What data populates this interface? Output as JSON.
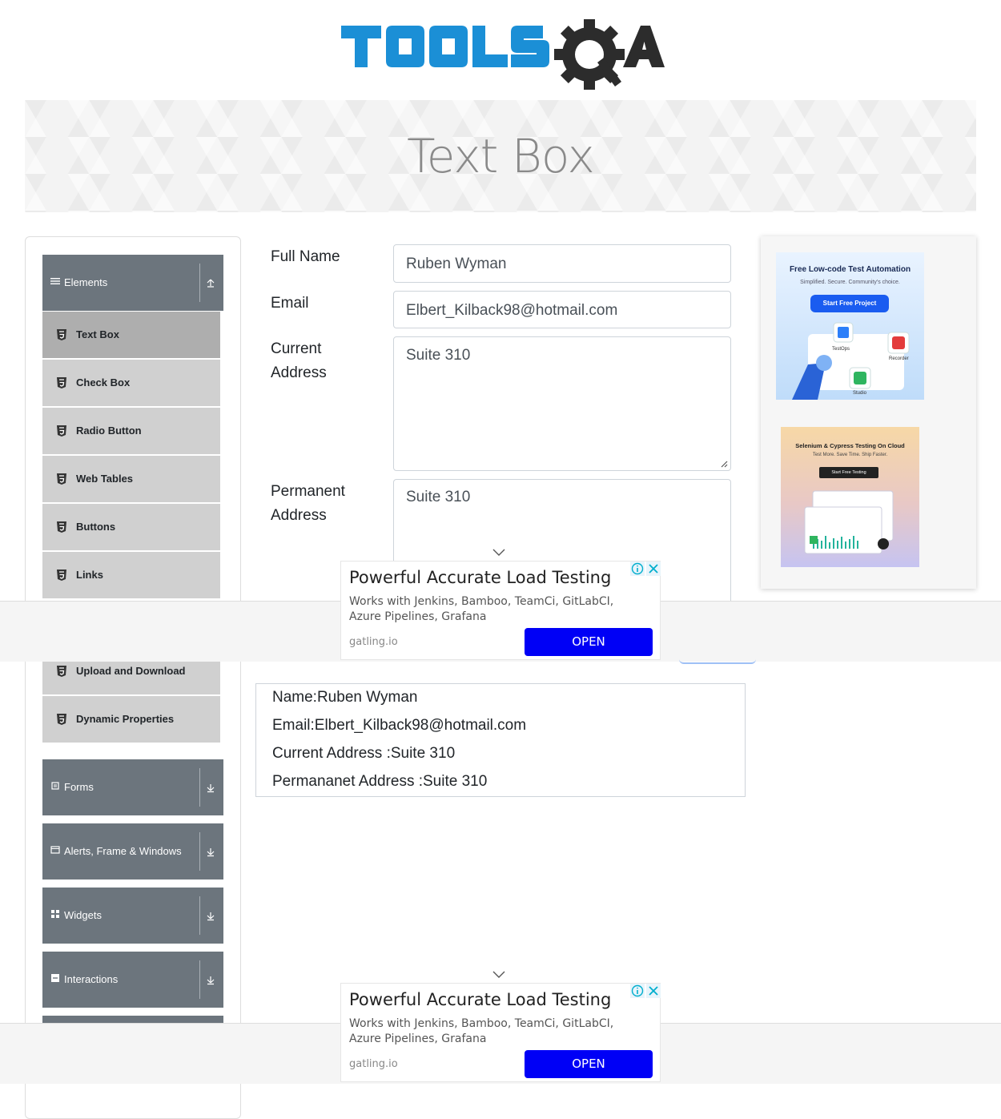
{
  "logo": {
    "text": "TOOLSQA"
  },
  "banner": {
    "title": "Text Box"
  },
  "sidebar": {
    "elements_group": {
      "label": "Elements",
      "icon": "hamburger-icon",
      "arrow": "collapse-up-icon"
    },
    "element_items": [
      {
        "label": "Text Box",
        "active": true
      },
      {
        "label": "Check Box"
      },
      {
        "label": "Radio Button"
      },
      {
        "label": "Web Tables"
      },
      {
        "label": "Buttons"
      },
      {
        "label": "Links"
      },
      {
        "label": "Upload and Download"
      },
      {
        "label": "Dynamic Properties"
      }
    ],
    "groups": [
      {
        "label": "Forms",
        "icon": "form-icon"
      },
      {
        "label": "Alerts, Frame & Windows",
        "icon": "window-icon"
      },
      {
        "label": "Widgets",
        "icon": "widgets-icon"
      },
      {
        "label": "Interactions",
        "icon": "interactions-icon"
      }
    ]
  },
  "form": {
    "full_name": {
      "label": "Full Name",
      "value": "Ruben Wyman"
    },
    "email": {
      "label": "Email",
      "value": "Elbert_Kilback98@hotmail.com"
    },
    "current_address": {
      "label_line1": "Current",
      "label_line2": "Address",
      "value": "Suite 310"
    },
    "permanent_address": {
      "label_line1": "Permanent",
      "label_line2": "Address",
      "value": "Suite 310"
    }
  },
  "output": {
    "name": "Name:Ruben Wyman",
    "email": "Email:Elbert_Kilback98@hotmail.com",
    "current": "Current Address :Suite 310",
    "permanent": "Permananet Address :Suite 310"
  },
  "ads": {
    "title": "Powerful Accurate Load Testing",
    "desc": "Works with Jenkins, Bamboo, TeamCi, GitLabCI, Azure Pipelines, Grafana",
    "domain": "gatling.io",
    "cta": "OPEN"
  },
  "side_ad_1": {
    "title": "Free Low-code Test Automation",
    "subtitle": "Simplified. Secure. Community's choice.",
    "cta": "Start Free Project",
    "labels": [
      "TestOps",
      "Recorder",
      "Studio"
    ]
  },
  "side_ad_2": {
    "title": "Selenium & Cypress Testing On Cloud",
    "subtitle": "Test More. Save Time. Ship Faster.",
    "cta": "Start Free Testing"
  },
  "colors": {
    "sidebar_header": "#6c757d",
    "menu_item": "#d0d0d0",
    "menu_active": "#aeaeae",
    "logo_blue": "#1b8fd6",
    "ad_button": "#0000f6"
  }
}
